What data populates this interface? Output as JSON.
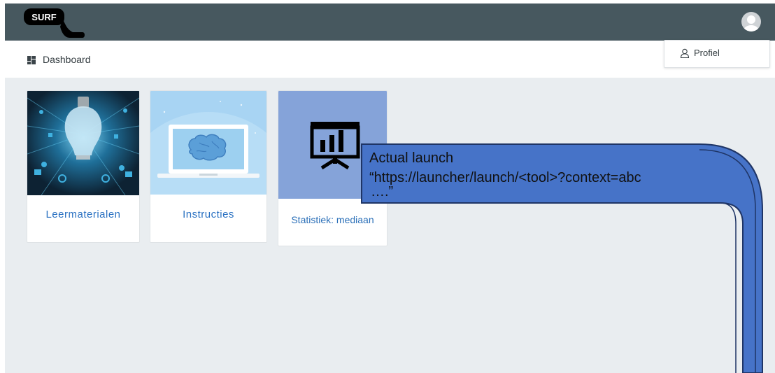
{
  "header": {
    "logo_text": "SURF",
    "avatar": "user-avatar-icon",
    "colors": {
      "bar": "#47585f",
      "subbar": "#ffffff",
      "background": "#e9edf0"
    }
  },
  "nav": {
    "dashboard_icon": "dashboard-grid-icon",
    "dashboard_label": "Dashboard"
  },
  "profile_menu": {
    "icon": "user-outline-icon",
    "label": "Profiel"
  },
  "cards": [
    {
      "title": "Leermaterialen",
      "image": "lightbulb-illustration",
      "color": "#0f2d40"
    },
    {
      "title": "Instructies",
      "image": "brain-laptop-illustration",
      "color": "#a8d4f3"
    },
    {
      "title": "Statistiek: mediaan",
      "image": "presentation-chart-icon",
      "color": "#85a3d9"
    }
  ],
  "title_color": "#2a71c2",
  "annotation": {
    "line1": "Actual launch",
    "line2": "“https://launcher/launch/<tool>?context=abc",
    "line3": "….”",
    "arrow_color": "#4673c8",
    "outline_color": "#1f3566"
  }
}
